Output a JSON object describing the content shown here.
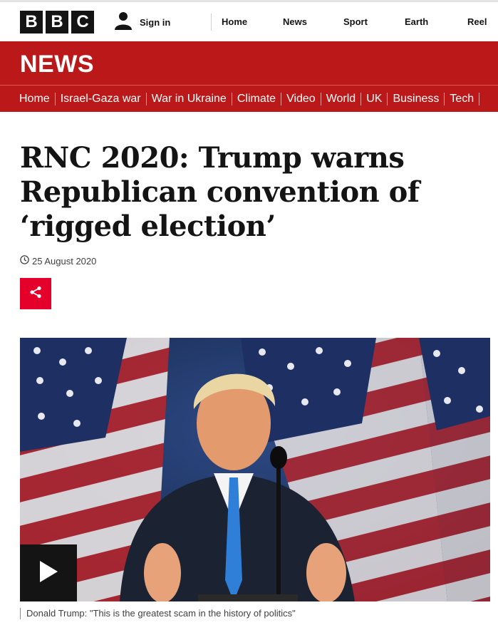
{
  "masthead": {
    "logo_letters": [
      "B",
      "B",
      "C"
    ],
    "signin_label": "Sign in",
    "nav": [
      "Home",
      "News",
      "Sport",
      "Earth",
      "Reel"
    ]
  },
  "section": {
    "title": "NEWS",
    "nav": [
      "Home",
      "Israel-Gaza war",
      "War in Ukraine",
      "Climate",
      "Video",
      "World",
      "UK",
      "Business",
      "Tech"
    ]
  },
  "article": {
    "headline": "RNC 2020: Trump warns Republican convention of ‘rigged election’",
    "date": "25 August 2020",
    "caption": "Donald Trump: \"This is the greatest scam in the history of politics\""
  },
  "colors": {
    "brand_red": "#bb1919",
    "share_red": "#e5002b",
    "ink": "#141414"
  }
}
